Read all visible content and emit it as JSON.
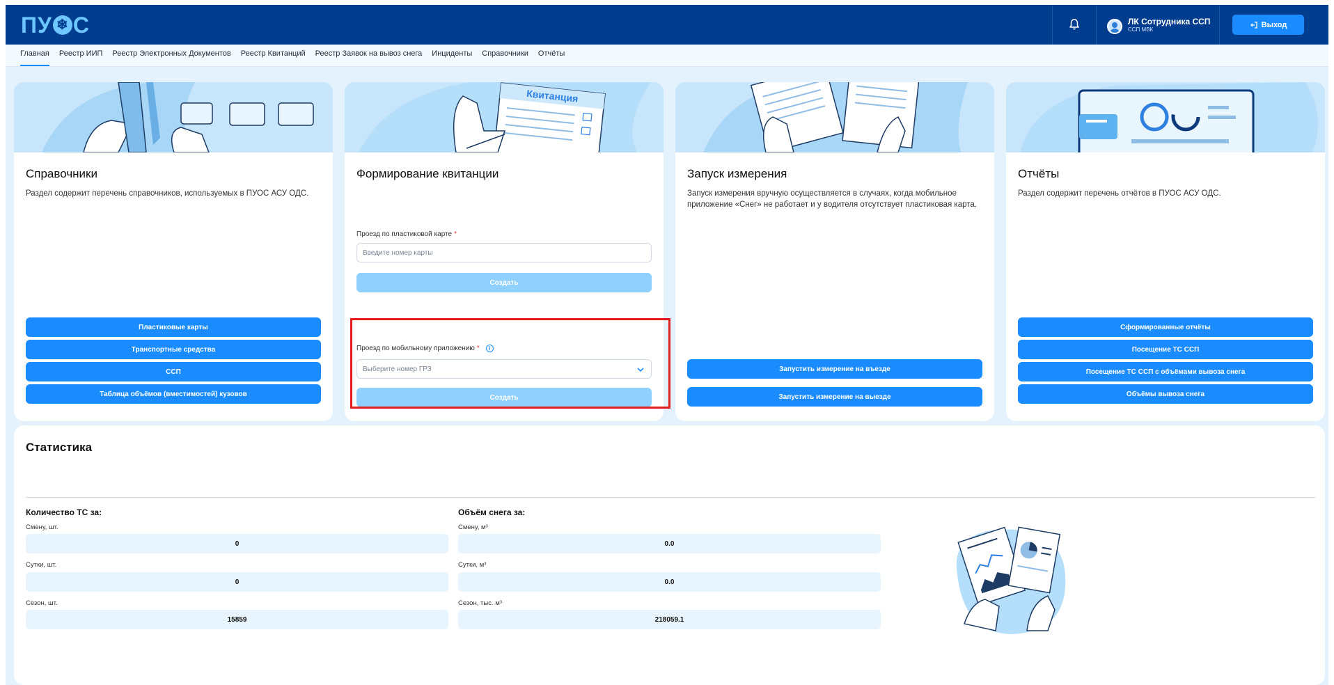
{
  "header": {
    "logo": {
      "left": "ПУ",
      "right": "С",
      "snow": "❄"
    },
    "user": {
      "name": "ЛК Сотрудника ССП",
      "org": "ССП МВК"
    },
    "logout_label": "Выход"
  },
  "nav": {
    "items": [
      {
        "label": "Главная",
        "active": true
      },
      {
        "label": "Реестр ИИП"
      },
      {
        "label": "Реестр Электронных Документов"
      },
      {
        "label": "Реестр Квитанций"
      },
      {
        "label": "Реестр Заявок на вывоз снега"
      },
      {
        "label": "Инциденты"
      },
      {
        "label": "Справочники"
      },
      {
        "label": "Отчёты"
      }
    ]
  },
  "cards": {
    "refs": {
      "title": "Справочники",
      "desc": "Раздел содержит перечень справочников, используемых в ПУОС АСУ ОДС.",
      "buttons": [
        "Пластиковые карты",
        "Транспортные средства",
        "ССП",
        "Таблица объёмов (вместимостей) кузовов"
      ]
    },
    "receipt": {
      "title": "Формирование квитанции",
      "illus_label": "Квитанция",
      "card_field": {
        "label": "Проезд по пластиковой карте",
        "required": "*",
        "placeholder": "Введите номер карты",
        "button": "Создать"
      },
      "app_field": {
        "label": "Проезд по мобильному приложению",
        "required": "*",
        "info": "i",
        "placeholder": "Выберите номер ГРЗ",
        "button": "Создать"
      }
    },
    "measure": {
      "title": "Запуск измерения",
      "desc": "Запуск измерения вручную осуществляется в случаях, когда мобильное приложение «Снег» не работает и у водителя отсутствует пластиковая карта.",
      "buttons": [
        "Запустить измерение на въезде",
        "Запустить измерение на выезде"
      ]
    },
    "reports": {
      "title": "Отчёты",
      "desc": "Раздел содержит перечень отчётов в ПУОС АСУ ОДС.",
      "buttons": [
        "Сформированные отчёты",
        "Посещение ТС ССП",
        "Посещение ТС ССП с объёмами вывоза снега",
        "Объёмы вывоза снега"
      ]
    }
  },
  "stats": {
    "title": "Статистика",
    "vehicles": {
      "title": "Количество ТС за:",
      "rows": [
        {
          "label": "Смену, шт.",
          "value": "0"
        },
        {
          "label": "Сутки, шт.",
          "value": "0"
        },
        {
          "label": "Сезон, шт.",
          "value": "15859"
        }
      ]
    },
    "snow": {
      "title": "Объём снега за:",
      "rows": [
        {
          "label": "Смену, м³",
          "value": "0.0"
        },
        {
          "label": "Сутки, м³",
          "value": "0.0"
        },
        {
          "label": "Сезон, тыс. м³",
          "value": "218059.1"
        }
      ]
    }
  },
  "colors": {
    "header": "#003d8f",
    "accent": "#1a8cff",
    "disabled": "#90d0ff",
    "highlight": "#e31b1b"
  },
  "icons": [
    "bell-icon",
    "avatar",
    "logout-icon",
    "info-icon",
    "chevron-down-icon"
  ]
}
